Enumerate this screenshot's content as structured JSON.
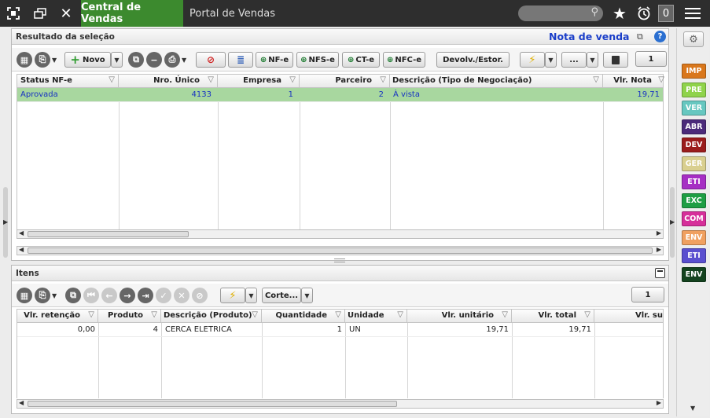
{
  "topbar": {
    "tabs": [
      "Central de Vendas",
      "Portal de Vendas"
    ],
    "counter": "0"
  },
  "icons": {
    "expand": "expand-icon",
    "windows": "windows-icon",
    "close": "close-icon",
    "search": "search-icon",
    "star": "star-icon",
    "alarm": "alarm-clock-icon",
    "menu": "hamburger-menu-icon",
    "gear": "gear-icon",
    "help": "help-icon"
  },
  "colors": {
    "active_tab": "#3c8a2e",
    "selected_row": "#a8d79f",
    "nota_title": "#1a3ec9"
  },
  "resultado": {
    "title": "Resultado da seleção",
    "nota_label": "Nota de venda",
    "toolbar": {
      "novo": "Novo",
      "nfe": "NF-e",
      "nfse": "NFS-e",
      "cte": "CT-e",
      "nfce": "NFC-e",
      "devolv": "Devolv./Estor.",
      "more": "...",
      "page": "1"
    },
    "columns": [
      "Status NF-e",
      "Nro. Único",
      "Empresa",
      "Parceiro",
      "Descrição (Tipo de Negociação)",
      "Vlr. Nota"
    ],
    "rows": [
      {
        "status": "Aprovada",
        "nro_unico": "4133",
        "empresa": "1",
        "parceiro": "2",
        "descricao": "À vista",
        "vlr_nota": "19,71"
      }
    ]
  },
  "itens": {
    "title": "Itens",
    "toolbar": {
      "corte": "Corte...",
      "page": "1"
    },
    "columns": [
      "Vlr. retenção",
      "Produto",
      "Descrição (Produto)",
      "Quantidade",
      "Unidade",
      "Vlr. unitário",
      "Vlr. total",
      "Vlr. su"
    ],
    "rows": [
      {
        "vlr_retencao": "0,00",
        "produto": "4",
        "descricao": "CERCA ELETRICA",
        "quantidade": "1",
        "unidade": "UN",
        "vlr_unitario": "19,71",
        "vlr_total": "19,71",
        "vlr_su": ""
      }
    ]
  },
  "sidebar_tags": [
    {
      "label": "IMP",
      "color": "#d9771c"
    },
    {
      "label": "PRE",
      "color": "#8fd34b"
    },
    {
      "label": "VER",
      "color": "#66c7c0"
    },
    {
      "label": "ABR",
      "color": "#4b2a7a"
    },
    {
      "label": "DEV",
      "color": "#9a1c1c"
    },
    {
      "label": "GER",
      "color": "#d9cf8f"
    },
    {
      "label": "ETI",
      "color": "#a62fc4"
    },
    {
      "label": "EXC",
      "color": "#1e9e44"
    },
    {
      "label": "COM",
      "color": "#d62f9a"
    },
    {
      "label": "ENV",
      "color": "#f0a060"
    },
    {
      "label": "ETI",
      "color": "#5a4fcf"
    },
    {
      "label": "ENV",
      "color": "#14431f"
    }
  ]
}
